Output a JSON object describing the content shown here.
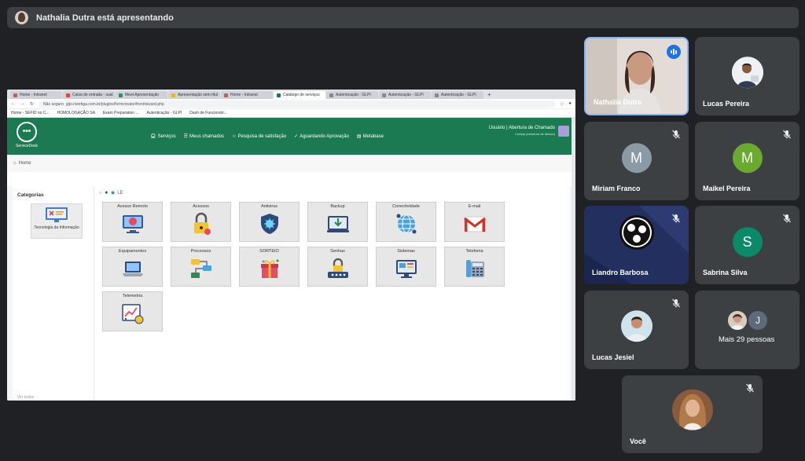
{
  "presenter_bar": {
    "title": "Nathalia Dutra está apresentando"
  },
  "browser": {
    "tabs": [
      "Home - Intranet",
      "Caixa de entrada - sust",
      "Meet Apresentação",
      "Apresentação sem títul",
      "Home - Intranet",
      "Catálogo de serviços",
      "Autenticação - GLPI",
      "Autenticação - GLPI",
      "Autenticação - GLPI"
    ],
    "new_tab": "+",
    "address_security": "Não seguro",
    "address": "glpi.rivertiga.com.br/plugins/formcreator/front/wizard.php",
    "bookmarks": [
      "Home - SEFID no C...",
      "HOMOLOGAÇÃO SA",
      "Exam Preparation ...",
      "Autenticação - GLPI",
      "Dash de Funcionári..."
    ]
  },
  "servicedesk": {
    "logo_text": "ServiceDesk",
    "nav": [
      {
        "icon": "headset-icon",
        "label": "Serviços"
      },
      {
        "icon": "list-icon",
        "label": "Meus chamados"
      },
      {
        "icon": "star-icon",
        "label": "Pesquisa de satisfação"
      },
      {
        "icon": "check-icon",
        "label": "Aguardando Aprovação"
      },
      {
        "icon": "book-icon",
        "label": "Metabase"
      }
    ],
    "user_line1": "Usuário | Abertura de Chamado",
    "user_line2": "Cortejo (estrutura de direcio)",
    "breadcrumb": "Home",
    "categories_title": "Categorias",
    "category_card": "Tecnologia da Informação",
    "filter_label": "LE",
    "services": [
      {
        "label": "Acesso Remoto",
        "icon": "remote-access-icon"
      },
      {
        "label": "Acessos",
        "icon": "padlock-icon"
      },
      {
        "label": "Antivirus",
        "icon": "shield-virus-icon"
      },
      {
        "label": "Backup",
        "icon": "backup-download-icon"
      },
      {
        "label": "Conectividade",
        "icon": "globe-network-icon"
      },
      {
        "label": "E-mail",
        "icon": "gmail-icon"
      },
      {
        "label": "Equipamentos",
        "icon": "laptop-icon"
      },
      {
        "label": "Processos",
        "icon": "process-flow-icon"
      },
      {
        "label": "SORTEIO",
        "icon": "gift-icon"
      },
      {
        "label": "Senhas",
        "icon": "password-lock-icon"
      },
      {
        "label": "Sistemas",
        "icon": "system-monitor-icon"
      },
      {
        "label": "Telefonia",
        "icon": "telephone-icon"
      },
      {
        "label": "Telemetria",
        "icon": "telemetry-chart-icon"
      }
    ],
    "footer_text": "Ver todos"
  },
  "participants": [
    {
      "name": "Nathalia Dutra",
      "kind": "video",
      "speaking": true
    },
    {
      "name": "Lucas Pereira",
      "kind": "photo",
      "muted": false
    },
    {
      "name": "Miriam Franco",
      "kind": "initial",
      "initial": "M",
      "color": "#8c9aa6",
      "muted": true
    },
    {
      "name": "Maikel Pereira",
      "kind": "initial",
      "initial": "M",
      "color": "#6aaa2f",
      "muted": true
    },
    {
      "name": "Liandro Barbosa",
      "kind": "obs",
      "muted": true
    },
    {
      "name": "Sabrina Silva",
      "kind": "initial",
      "initial": "S",
      "color": "#0b8a6a",
      "muted": true
    },
    {
      "name": "Lucas Jesiel",
      "kind": "photo",
      "muted": true
    },
    {
      "name": "Mais 29 pessoas",
      "kind": "group",
      "initial": "J",
      "muted": false
    },
    {
      "name": "Você",
      "kind": "photo",
      "muted": true
    }
  ]
}
